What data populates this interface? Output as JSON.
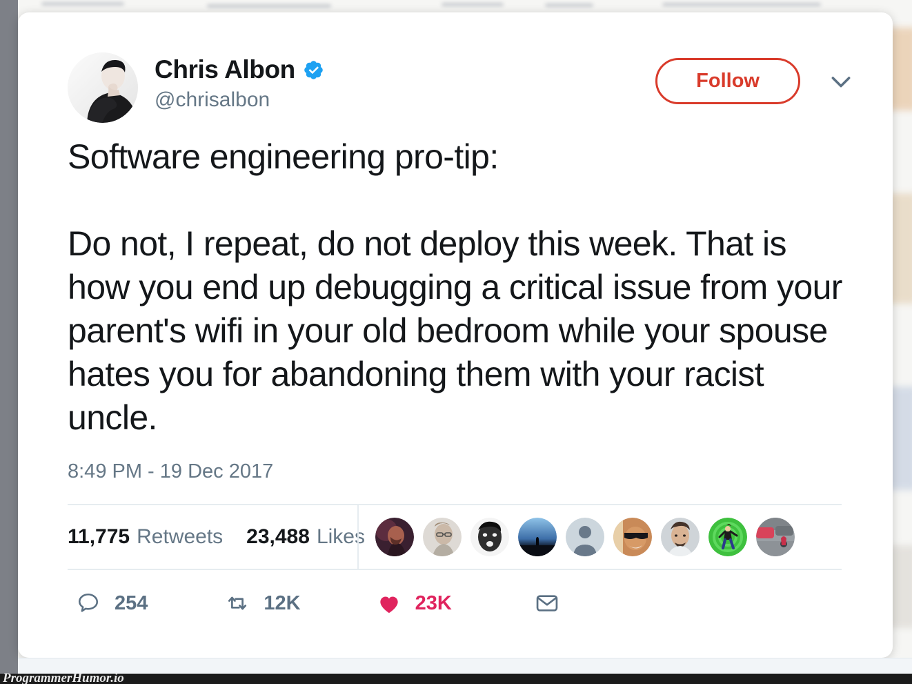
{
  "background": {
    "description": "blurred web page of handwritten lecture notes behind the tweet card"
  },
  "tweet": {
    "author": {
      "display_name": "Chris Albon",
      "handle": "@chrisalbon",
      "verified": true,
      "verified_badge_color": "#1da1f2",
      "avatar_name": "chris-albon-avatar"
    },
    "header_actions": {
      "follow_label": "Follow",
      "follow_color": "#d93b2b",
      "caret_icon": "chevron-down-icon"
    },
    "body": "Software engineering pro-tip:\n\nDo not, I repeat, do not deploy this week. That is how you end up debugging a critical issue from your parent's wifi in your old bedroom while your spouse hates you for abandoning them with your racist uncle.",
    "timestamp": "8:49 PM - 19 Dec 2017",
    "stats": {
      "retweets_count": "11,775",
      "retweets_label": "Retweets",
      "likes_count": "23,488",
      "likes_label": "Likes"
    },
    "facepile": [
      {
        "name": "liker-avatar-1",
        "colors": [
          "#4a2a3a",
          "#8a4a48",
          "#2d1820"
        ]
      },
      {
        "name": "liker-avatar-2",
        "colors": [
          "#ddd9d4",
          "#b9ada0",
          "#8e8479"
        ]
      },
      {
        "name": "liker-avatar-3",
        "colors": [
          "#f2f2f2",
          "#3a3a3a",
          "#111111"
        ]
      },
      {
        "name": "liker-avatar-4",
        "colors": [
          "#7fb4e0",
          "#2a4a7a",
          "#101a2a"
        ]
      },
      {
        "name": "liker-avatar-default-egg",
        "colors": [
          "#ccd6dd",
          "#657786",
          "#657786"
        ]
      },
      {
        "name": "liker-avatar-6",
        "colors": [
          "#c97a4a",
          "#e0a070",
          "#241b16"
        ]
      },
      {
        "name": "liker-avatar-7",
        "colors": [
          "#cfd4d8",
          "#6e5444",
          "#3a2d26"
        ]
      },
      {
        "name": "liker-avatar-8",
        "colors": [
          "#3ec03e",
          "#2a9a2a",
          "#17400f"
        ]
      },
      {
        "name": "liker-avatar-9",
        "colors": [
          "#9aa0a5",
          "#d8435a",
          "#5a6268"
        ]
      }
    ],
    "actions": {
      "reply": {
        "icon": "reply-bubble-icon",
        "count": "254"
      },
      "retweet": {
        "icon": "retweet-icon",
        "count": "12K"
      },
      "like": {
        "icon": "heart-icon",
        "count": "23K",
        "color": "#e0245e"
      },
      "dm": {
        "icon": "envelope-icon",
        "count": ""
      }
    }
  },
  "watermark": {
    "text": "ProgrammerHumor.io"
  }
}
